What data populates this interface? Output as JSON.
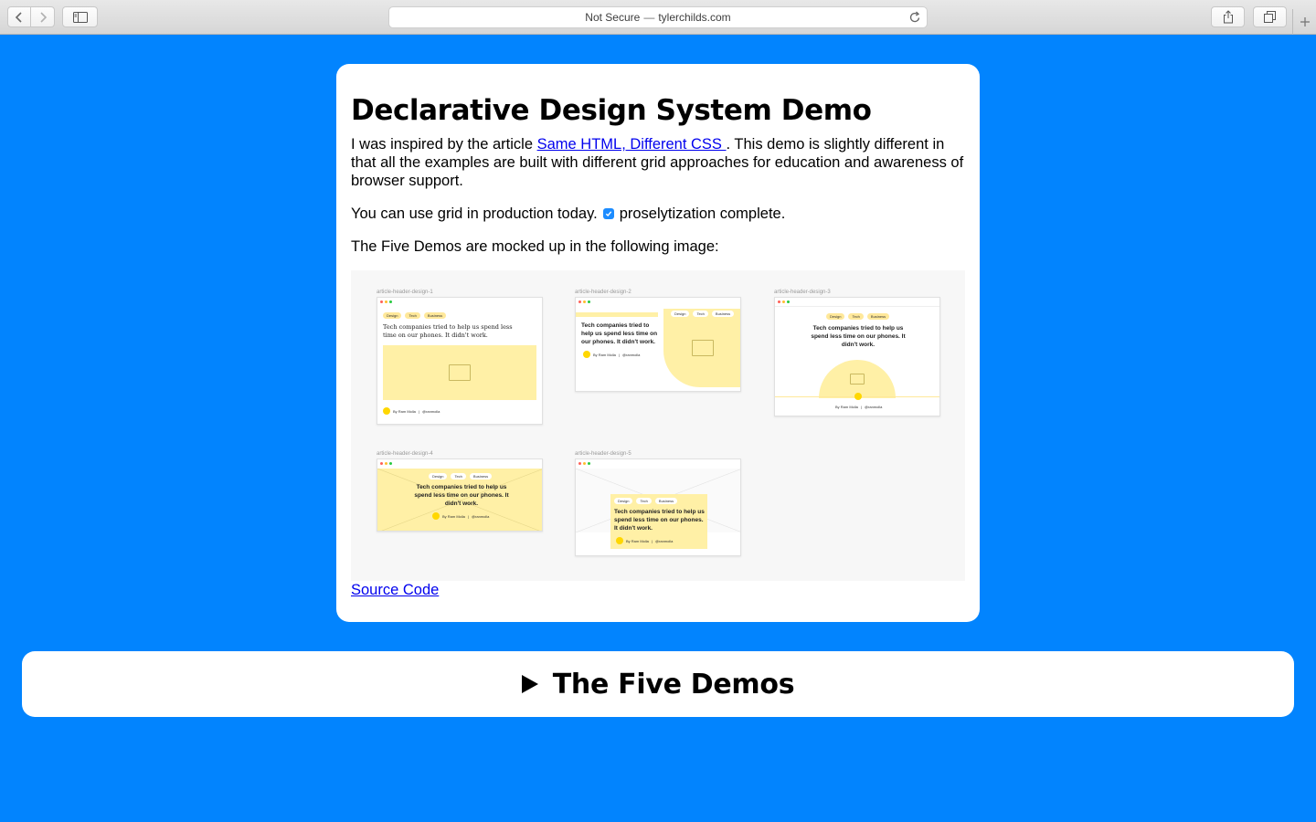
{
  "browser": {
    "security_label": "Not Secure",
    "separator": "—",
    "domain": "tylerchilds.com"
  },
  "card": {
    "title": "Declarative Design System Demo",
    "intro_before_link": "I was inspired by the article ",
    "article_link": "Same HTML, Different CSS ",
    "intro_after_link": ". This demo is slightly different in that all the examples are built with different grid approaches for education and awareness of browser support.",
    "grid_text": "You can use grid in production today.",
    "grid_checkbox_checked": true,
    "grid_suffix": "proselytization complete.",
    "mock_intro": "The Five Demos are mocked up in the following image:",
    "source_link": "Source Code"
  },
  "mock": {
    "demos": [
      {
        "label": "article-header-design-1"
      },
      {
        "label": "article-header-design-2"
      },
      {
        "label": "article-header-design-3"
      },
      {
        "label": "article-header-design-4"
      },
      {
        "label": "article-header-design-5"
      }
    ],
    "tags": [
      "Design",
      "Tech",
      "Business"
    ],
    "headline": "Tech companies tried to help us spend less time on our phones. It didn't work.",
    "byline_author": "By Ram Molla",
    "byline_divider": "|",
    "byline_handle": "@ranmolla",
    "dot_colors": [
      "#ff5f57",
      "#ffbd2e",
      "#28c940"
    ],
    "accent_yellow": "#fff0a6"
  },
  "details": {
    "summary": "The Five Demos"
  },
  "colors": {
    "page_background": "#0284fe",
    "link": "#0000ee"
  }
}
